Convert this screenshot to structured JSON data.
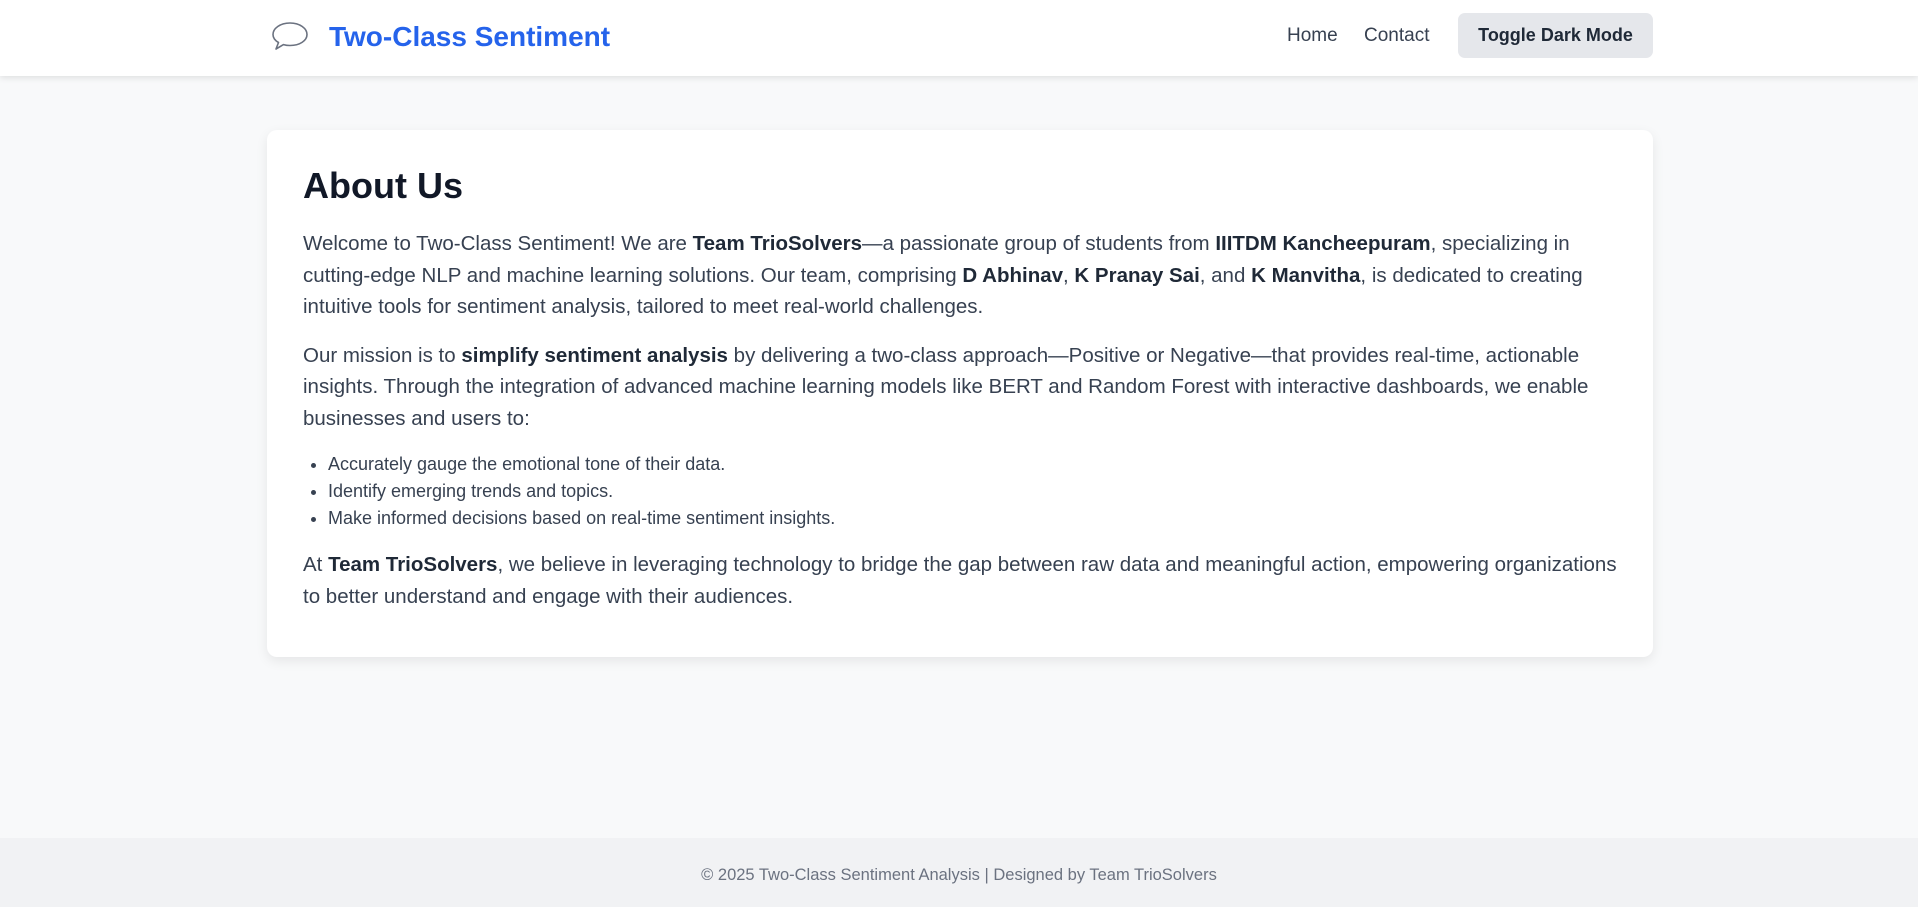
{
  "header": {
    "logo_icon": "speech-bubble-icon",
    "brand": "Two-Class Sentiment",
    "nav": {
      "home": "Home",
      "contact": "Contact"
    },
    "toggle_label": "Toggle Dark Mode",
    "brand_color": "#2563eb"
  },
  "about": {
    "title": "About Us",
    "p1": {
      "t1": "Welcome to Two-Class Sentiment! We are ",
      "b1": "Team TrioSolvers",
      "t2": "—a passionate group of students from ",
      "b2": "IIITDM Kancheepuram",
      "t3": ", specializing in cutting-edge NLP and machine learning solutions. Our team, comprising ",
      "b3": "D Abhinav",
      "t4": ", ",
      "b4": "K Pranay Sai",
      "t5": ", and ",
      "b5": "K Manvitha",
      "t6": ", is dedicated to creating intuitive tools for sentiment analysis, tailored to meet real-world challenges."
    },
    "p2": {
      "t1": "Our mission is to ",
      "b1": "simplify sentiment analysis",
      "t2": " by delivering a two-class approach—Positive or Negative—that provides real-time, actionable insights. Through the integration of advanced machine learning models like BERT and Random Forest with interactive dashboards, we enable businesses and users to:"
    },
    "bullets": [
      "Accurately gauge the emotional tone of their data.",
      "Identify emerging trends and topics.",
      "Make informed decisions based on real-time sentiment insights."
    ],
    "p3": {
      "t1": "At ",
      "b1": "Team TrioSolvers",
      "t2": ", we believe in leveraging technology to bridge the gap between raw data and meaningful action, empowering organizations to better understand and engage with their audiences."
    }
  },
  "footer": {
    "text": "© 2025 Two-Class Sentiment Analysis | Designed by Team TrioSolvers"
  }
}
